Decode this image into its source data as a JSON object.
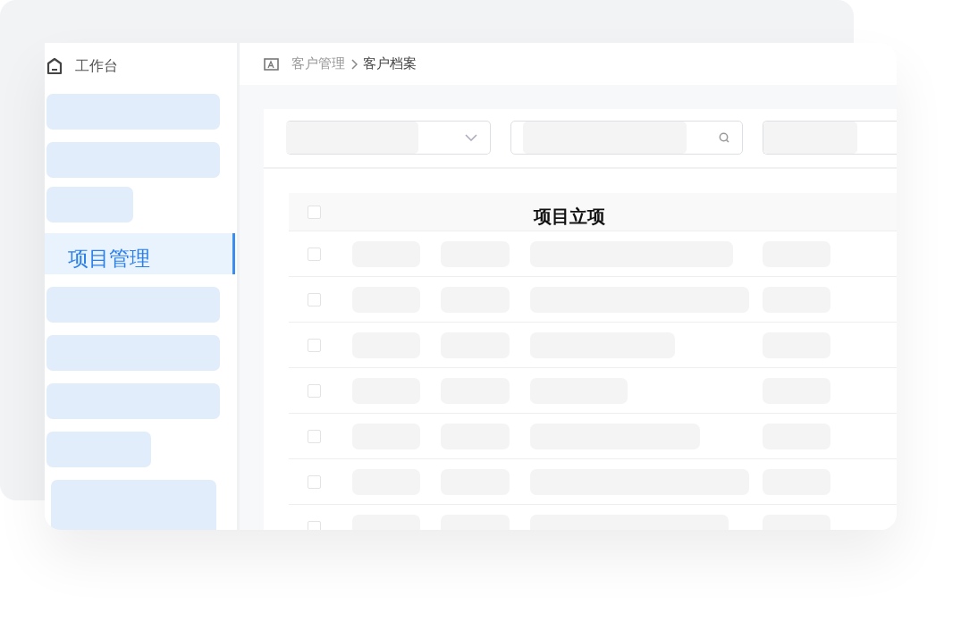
{
  "sidebar": {
    "header": {
      "label": "工作台"
    },
    "items": [
      {
        "kind": "placeholder",
        "selected": false
      },
      {
        "kind": "placeholder",
        "selected": false
      },
      {
        "kind": "placeholder",
        "selected": false
      },
      {
        "kind": "item",
        "label": "项目管理",
        "selected": true
      },
      {
        "kind": "placeholder",
        "selected": false
      },
      {
        "kind": "placeholder",
        "selected": false
      },
      {
        "kind": "placeholder",
        "selected": false
      },
      {
        "kind": "placeholder",
        "selected": false
      },
      {
        "kind": "placeholder",
        "selected": false
      }
    ]
  },
  "breadcrumb": [
    {
      "label": "客户管理",
      "current": false
    },
    {
      "label": "客户档案",
      "current": true
    }
  ],
  "filters": [
    {
      "kind": "select"
    },
    {
      "kind": "search"
    },
    {
      "kind": "plain"
    }
  ],
  "table": {
    "title": "项目立项",
    "header_checked": false,
    "rows": [
      {
        "checked": false
      },
      {
        "checked": false
      },
      {
        "checked": false
      },
      {
        "checked": false
      },
      {
        "checked": false
      },
      {
        "checked": false
      },
      {
        "checked": false
      }
    ]
  }
}
